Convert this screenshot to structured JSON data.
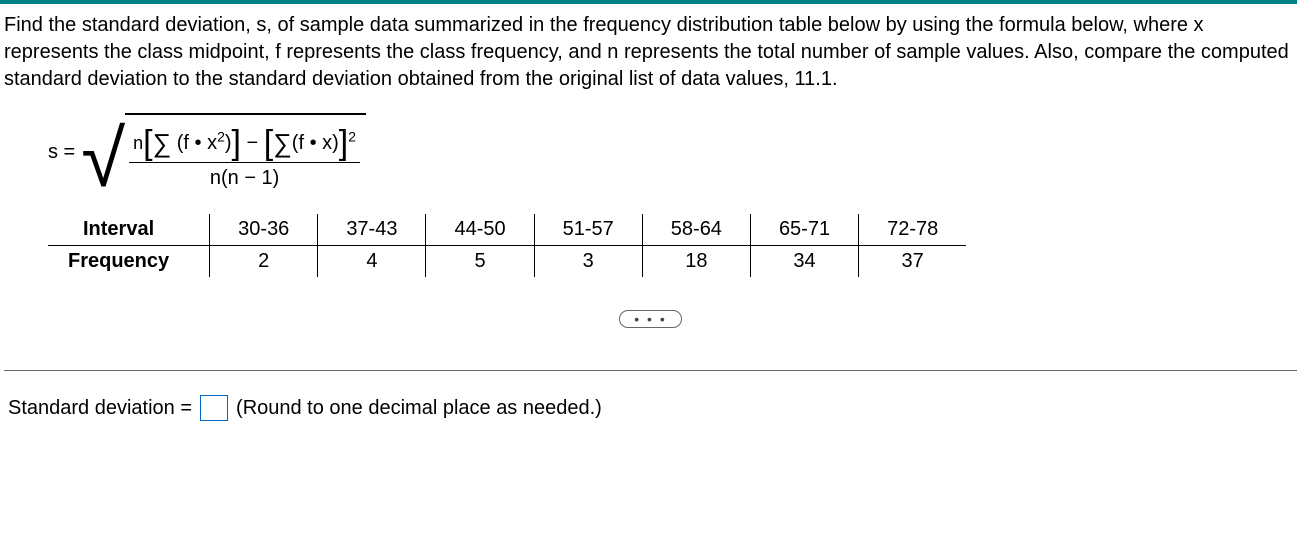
{
  "problem": {
    "text": "Find the standard deviation, s, of sample data summarized in the frequency distribution table below by using the formula below, where x represents the class midpoint, f represents the class frequency, and n represents the total number of sample values. Also, compare the computed standard deviation to the standard deviation obtained from the original list of data values, 11.1."
  },
  "formula": {
    "lhs": "s =",
    "numerator_prefix": "n",
    "sigma": "∑",
    "term_fx2_open": "(",
    "term_fx2_body": "f • x",
    "term_fx2_exp": "2",
    "term_fx2_close": ")",
    "minus": " − ",
    "term_fx_body": "(f • x)",
    "outer_exp": "2",
    "denominator": "n(n − 1)"
  },
  "table": {
    "row1_label": "Interval",
    "row2_label": "Frequency",
    "cols": [
      {
        "interval": "30-36",
        "freq": "2"
      },
      {
        "interval": "37-43",
        "freq": "4"
      },
      {
        "interval": "44-50",
        "freq": "5"
      },
      {
        "interval": "51-57",
        "freq": "3"
      },
      {
        "interval": "58-64",
        "freq": "18"
      },
      {
        "interval": "65-71",
        "freq": "34"
      },
      {
        "interval": "72-78",
        "freq": "37"
      }
    ]
  },
  "ellipsis": "• • •",
  "answer": {
    "label": "Standard deviation =",
    "hint": "(Round to one decimal place as needed.)",
    "value": ""
  }
}
